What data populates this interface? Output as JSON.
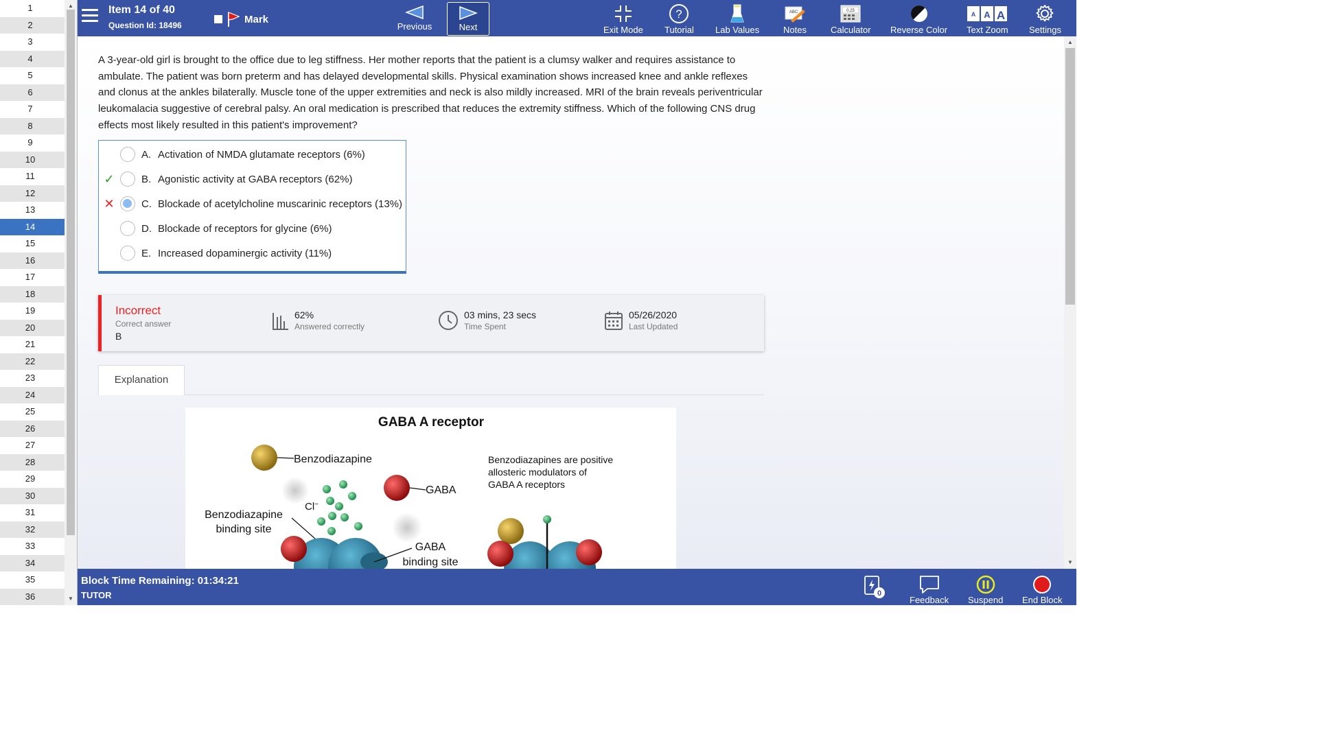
{
  "sidebar": {
    "items": [
      "1",
      "2",
      "3",
      "4",
      "5",
      "6",
      "7",
      "8",
      "9",
      "10",
      "11",
      "12",
      "13",
      "14",
      "15",
      "16",
      "17",
      "18",
      "19",
      "20",
      "21",
      "22",
      "23",
      "24",
      "25",
      "26",
      "27",
      "28",
      "29",
      "30",
      "31",
      "32",
      "33",
      "34",
      "35",
      "36"
    ],
    "current_index": 13
  },
  "header": {
    "item_title": "Item 14 of 40",
    "question_id": "Question Id: 18496",
    "mark_label": "Mark",
    "previous_label": "Previous",
    "next_label": "Next",
    "tools": [
      {
        "label": "Exit Mode",
        "icon": "exit-mode-icon"
      },
      {
        "label": "Tutorial",
        "icon": "tutorial-icon"
      },
      {
        "label": "Lab Values",
        "icon": "lab-values-icon"
      },
      {
        "label": "Notes",
        "icon": "notes-icon"
      },
      {
        "label": "Calculator",
        "icon": "calculator-icon"
      },
      {
        "label": "Reverse Color",
        "icon": "reverse-color-icon"
      },
      {
        "label": "Text Zoom",
        "icon": "text-zoom-icon"
      },
      {
        "label": "Settings",
        "icon": "gear-icon"
      }
    ]
  },
  "question": {
    "stem": "A 3-year-old girl is brought to the office due to leg stiffness.  Her mother reports that the patient is a clumsy walker and requires assistance to ambulate.  The patient was born preterm and has delayed developmental skills.  Physical examination shows increased knee and ankle reflexes and clonus at the ankles bilaterally.  Muscle tone of the upper extremities and neck is also mildly increased.  MRI of the brain reveals periventricular leukomalacia suggestive of cerebral palsy.  An oral medication is prescribed that reduces the extremity stiffness.  Which of the following CNS drug effects most likely resulted in this patient's improvement?",
    "choices": [
      {
        "letter": "A.",
        "text": "Activation of NMDA glutamate receptors (6%)",
        "status": "",
        "selected": false
      },
      {
        "letter": "B.",
        "text": "Agonistic activity at GABA receptors (62%)",
        "status": "correct",
        "selected": false
      },
      {
        "letter": "C.",
        "text": "Blockade of acetylcholine muscarinic receptors (13%)",
        "status": "incorrect",
        "selected": true
      },
      {
        "letter": "D.",
        "text": "Blockade of receptors for glycine (6%)",
        "status": "",
        "selected": false
      },
      {
        "letter": "E.",
        "text": "Increased dopaminergic activity (11%)",
        "status": "",
        "selected": false
      }
    ]
  },
  "result": {
    "status": "Incorrect",
    "correct_answer_label": "Correct answer",
    "correct_answer": "B",
    "percent": "62%",
    "percent_label": "Answered correctly",
    "time": "03 mins, 23 secs",
    "time_label": "Time Spent",
    "date": "05/26/2020",
    "date_label": "Last Updated"
  },
  "explanation": {
    "tab_label": "Explanation",
    "figure": {
      "title": "GABA A receptor",
      "benzodiazapine": "Benzodiazapine",
      "gaba": "GABA",
      "chloride": "Cl",
      "chloride_sup": "−",
      "bz_site_line1": "Benzodiazapine",
      "bz_site_line2": "binding site",
      "gaba_site_line1": "GABA",
      "gaba_site_line2": "binding site",
      "note_line1": "Benzodiazapines are positive",
      "note_line2": "allosteric modulators of",
      "note_line3": "GABA A receptors"
    }
  },
  "footer": {
    "block_time": "Block Time Remaining: 01:34:21",
    "mode": "TUTOR",
    "flash_count": "0",
    "feedback_label": "Feedback",
    "suspend_label": "Suspend",
    "end_block_label": "End Block"
  },
  "colors": {
    "bar": "#3852a4",
    "accent": "#3a73c2",
    "incorrect": "#e22222",
    "correct": "#2aa02a"
  }
}
